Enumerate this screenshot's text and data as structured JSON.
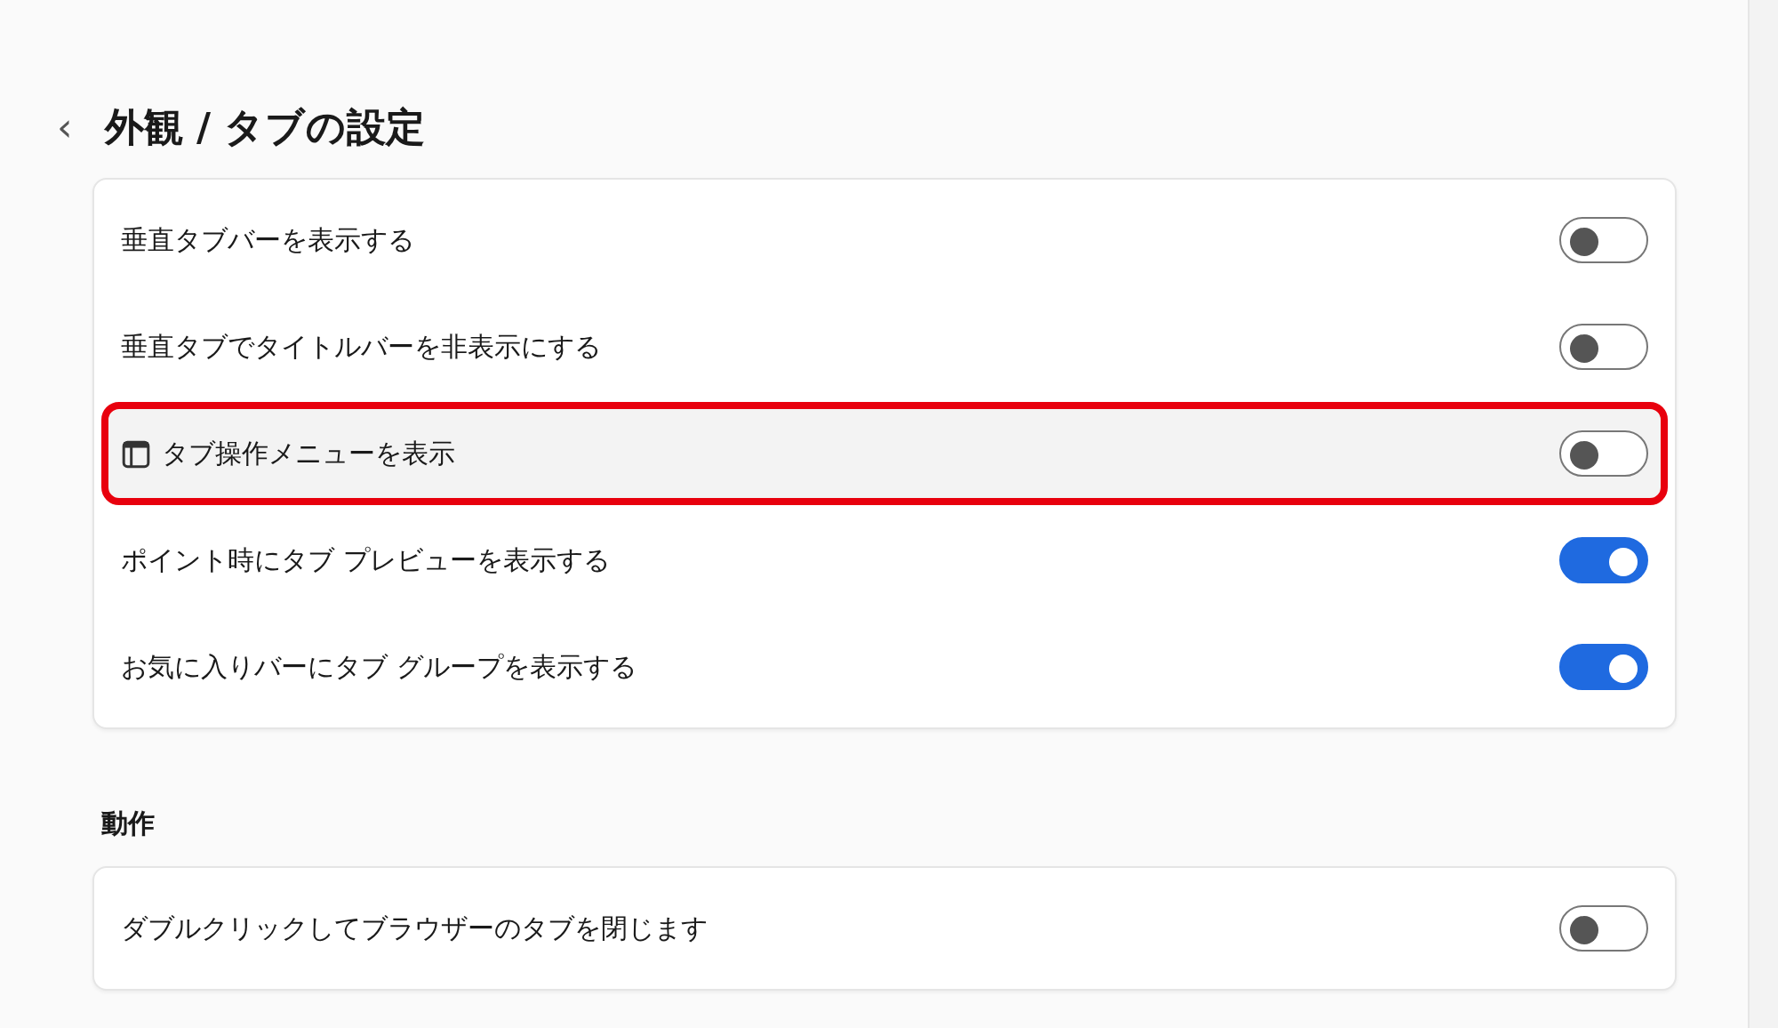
{
  "header": {
    "back": "‹",
    "title": "外観 / タブの設定"
  },
  "sections": [
    {
      "items": [
        {
          "label": "垂直タブバーを表示する",
          "on": false,
          "highlighted": false,
          "icon": false
        },
        {
          "label": "垂直タブでタイトルバーを非表示にする",
          "on": false,
          "highlighted": false,
          "icon": false
        },
        {
          "label": "タブ操作メニューを表示",
          "on": false,
          "highlighted": true,
          "icon": true
        },
        {
          "label": "ポイント時にタブ プレビューを表示する",
          "on": true,
          "highlighted": false,
          "icon": false
        },
        {
          "label": "お気に入りバーにタブ グループを表示する",
          "on": true,
          "highlighted": false,
          "icon": false
        }
      ]
    },
    {
      "heading": "動作",
      "items": [
        {
          "label": "ダブルクリックしてブラウザーのタブを閉じます",
          "on": false,
          "highlighted": false,
          "icon": false
        }
      ]
    }
  ]
}
